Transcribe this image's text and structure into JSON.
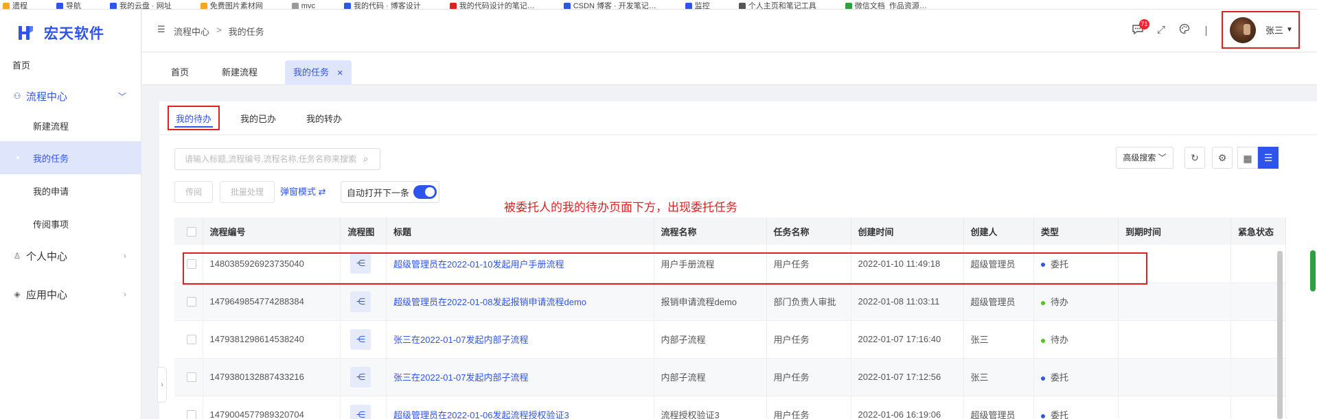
{
  "colors": {
    "accent": "#2f54eb",
    "annotation": "#e02020",
    "status_delegated": "#2f54eb",
    "status_pending": "#52c41a"
  },
  "browser": {
    "bookmarks": [
      "遗程",
      "导航",
      "我的云盘 · 网址",
      "免费图片素材网",
      "mvc",
      "我的代码 · 博客设计",
      "我的代码设计的笔记…",
      "CSDN 博客 · 开发笔记…",
      "监控",
      "个人主页和笔记工具",
      "微信文档_作品资源…"
    ]
  },
  "sidebar": {
    "logo_text": "宏天软件",
    "home": "首页",
    "groups": [
      {
        "label": "流程中心",
        "icon": "flow-center-icon",
        "expanded": true,
        "items": [
          "新建流程",
          "我的任务",
          "我的申请",
          "传阅事项"
        ],
        "active_item": "我的任务"
      },
      {
        "label": "个人中心",
        "icon": "user-icon",
        "expanded": false
      },
      {
        "label": "应用中心",
        "icon": "apps-icon",
        "expanded": false
      }
    ]
  },
  "header": {
    "breadcrumb": [
      "流程中心",
      "我的任务"
    ],
    "message_count": "71",
    "user_name": "张三"
  },
  "page_tabs": [
    {
      "label": "首页",
      "active": false
    },
    {
      "label": "新建流程",
      "active": false
    },
    {
      "label": "我的任务",
      "active": true,
      "closable": true
    }
  ],
  "task_tabs": [
    "我的待办",
    "我的已办",
    "我的转办"
  ],
  "toolbar": {
    "search_placeholder": "请输入标题,流程编号,流程名称,任务名称来搜索",
    "advanced_search": "高级搜索",
    "forward_button": "传阅",
    "batch_button": "批量处理",
    "popup_mode": "弹窗模式",
    "auto_open_next": "自动打开下一条",
    "auto_open_enabled": true
  },
  "annotation": "被委托人的我的待办页面下方，出现委托任务",
  "table": {
    "columns": [
      "流程编号",
      "流程图",
      "标题",
      "流程名称",
      "任务名称",
      "创建时间",
      "创建人",
      "类型",
      "到期时间",
      "紧急状态"
    ],
    "rows": [
      {
        "id": "1480385926923735040",
        "title": "超级管理员在2022-01-10发起用户手册流程",
        "process": "用户手册流程",
        "task": "用户任务",
        "created": "2022-01-10 11:49:18",
        "creator": "超级管理员",
        "type": "委托",
        "type_status": "delegated",
        "due": "",
        "urgency": ""
      },
      {
        "id": "1479649854774288384",
        "title": "超级管理员在2022-01-08发起报销申请流程demo",
        "process": "报销申请流程demo",
        "task": "部门负责人审批",
        "created": "2022-01-08 11:03:11",
        "creator": "超级管理员",
        "type": "待办",
        "type_status": "pending",
        "due": "",
        "urgency": ""
      },
      {
        "id": "1479381298614538240",
        "title": "张三在2022-01-07发起内部子流程",
        "process": "内部子流程",
        "task": "用户任务",
        "created": "2022-01-07 17:16:40",
        "creator": "张三",
        "type": "待办",
        "type_status": "pending",
        "due": "",
        "urgency": ""
      },
      {
        "id": "1479380132887433216",
        "title": "张三在2022-01-07发起内部子流程",
        "process": "内部子流程",
        "task": "用户任务",
        "created": "2022-01-07 17:12:56",
        "creator": "张三",
        "type": "委托",
        "type_status": "delegated",
        "due": "",
        "urgency": ""
      },
      {
        "id": "1479004577989320704",
        "title": "超级管理员在2022-01-06发起流程授权验证3",
        "process": "流程授权验证3",
        "task": "用户任务",
        "created": "2022-01-06 16:19:06",
        "creator": "超级管理员",
        "type": "委托",
        "type_status": "delegated",
        "due": "",
        "urgency": ""
      }
    ]
  }
}
